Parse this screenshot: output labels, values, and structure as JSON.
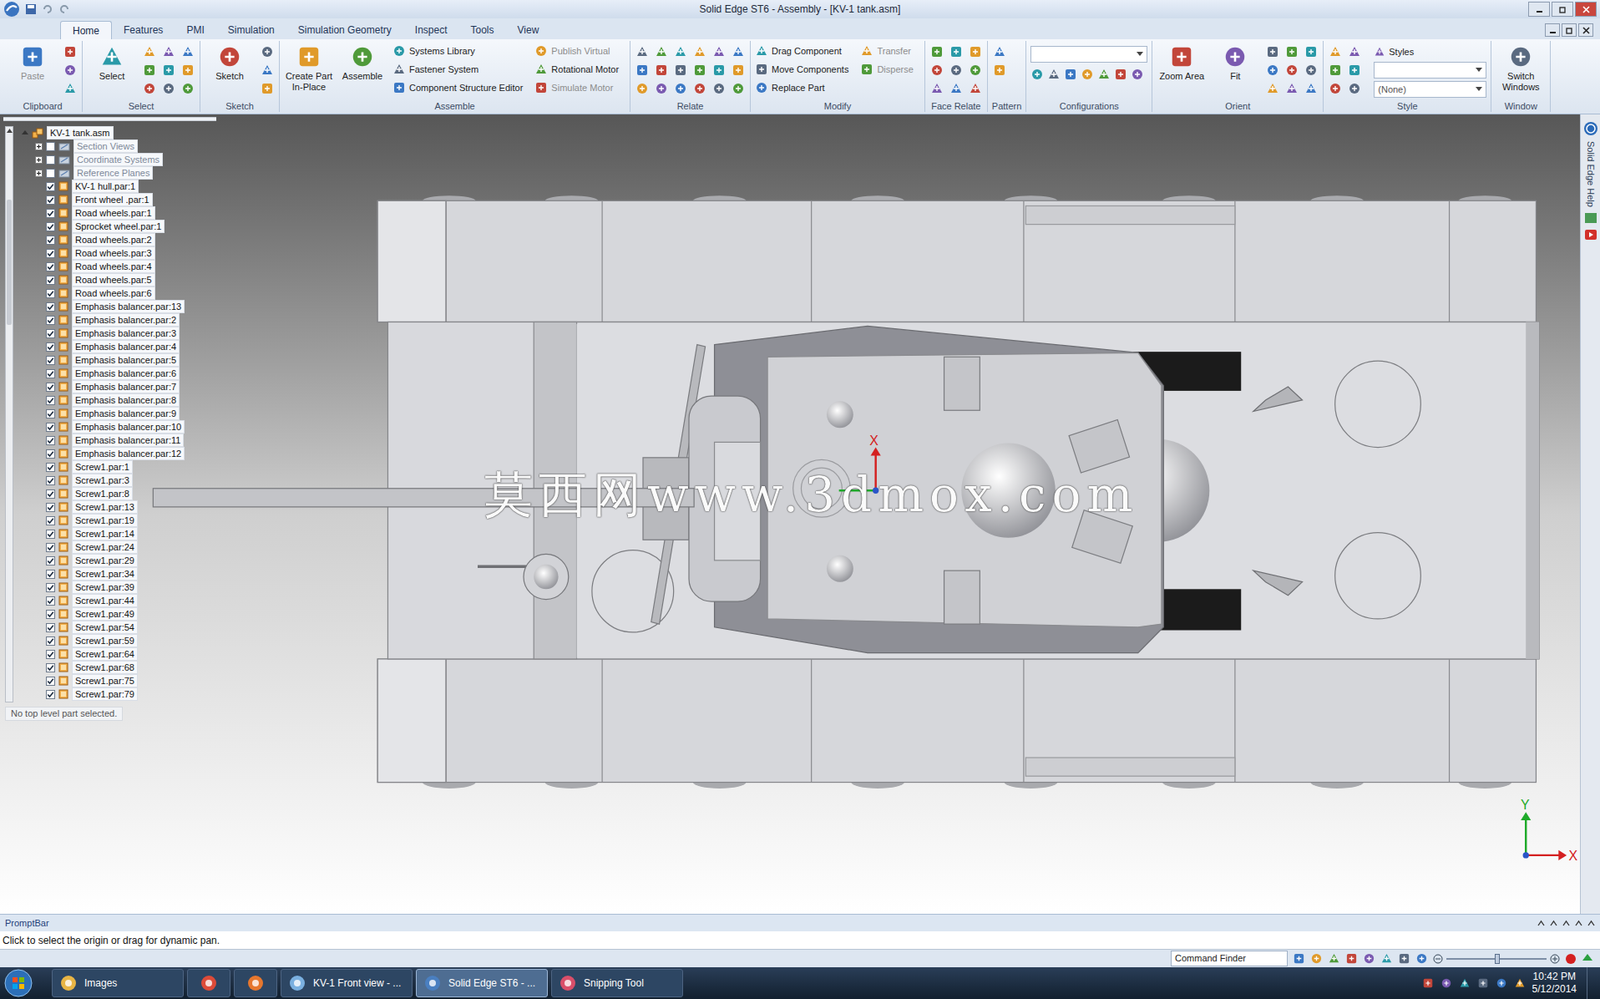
{
  "window": {
    "title": "Solid Edge ST6 - Assembly - [KV-1 tank.asm]"
  },
  "ribbon_tabs": [
    {
      "label": "Home",
      "selected": true
    },
    {
      "label": "Features",
      "selected": false
    },
    {
      "label": "PMI",
      "selected": false
    },
    {
      "label": "Simulation",
      "selected": false
    },
    {
      "label": "Simulation Geometry",
      "selected": false
    },
    {
      "label": "Inspect",
      "selected": false
    },
    {
      "label": "Tools",
      "selected": false
    },
    {
      "label": "View",
      "selected": false
    }
  ],
  "ribbon_groups": [
    {
      "label": "Clipboard",
      "columns": [
        {
          "kind": "large",
          "buttons": [
            {
              "label": "Paste",
              "disabled": true
            }
          ]
        },
        {
          "kind": "icons",
          "icons": 3
        }
      ]
    },
    {
      "label": "Select",
      "columns": [
        {
          "kind": "large",
          "buttons": [
            {
              "label": "Select",
              "disabled": false
            }
          ]
        },
        {
          "kind": "icons",
          "icons": 9
        }
      ]
    },
    {
      "label": "Sketch",
      "columns": [
        {
          "kind": "large",
          "buttons": [
            {
              "label": "Sketch",
              "disabled": false
            }
          ]
        },
        {
          "kind": "icons",
          "icons": 3
        }
      ]
    },
    {
      "label": "Assemble",
      "columns": [
        {
          "kind": "large",
          "buttons": [
            {
              "label": "Create Part In-Place",
              "disabled": false
            },
            {
              "label": "Assemble",
              "disabled": false
            }
          ]
        },
        {
          "kind": "small",
          "buttons": [
            {
              "label": "Systems Library",
              "disabled": false
            },
            {
              "label": "Fastener System",
              "disabled": false
            },
            {
              "label": "Component Structure Editor",
              "disabled": false
            }
          ]
        },
        {
          "kind": "small",
          "buttons": [
            {
              "label": "Publish Virtual",
              "disabled": true
            },
            {
              "label": "Rotational Motor",
              "disabled": false
            },
            {
              "label": "Simulate Motor",
              "disabled": true
            }
          ]
        }
      ]
    },
    {
      "label": "Relate",
      "columns": [
        {
          "kind": "icons",
          "icons": 18
        }
      ]
    },
    {
      "label": "Modify",
      "columns": [
        {
          "kind": "small",
          "buttons": [
            {
              "label": "Drag Component",
              "disabled": false
            },
            {
              "label": "Move Components",
              "disabled": false
            },
            {
              "label": "Replace Part",
              "disabled": false
            }
          ]
        },
        {
          "kind": "small",
          "buttons": [
            {
              "label": "Transfer",
              "disabled": true
            },
            {
              "label": "Disperse",
              "disabled": true
            }
          ]
        }
      ]
    },
    {
      "label": "Face Relate",
      "columns": [
        {
          "kind": "icons",
          "icons": 9
        }
      ]
    },
    {
      "label": "Pattern",
      "columns": [
        {
          "kind": "icons",
          "icons": 2
        }
      ]
    },
    {
      "label": "Configurations",
      "columns": [
        {
          "kind": "dropdown",
          "value": "",
          "icons": 7
        }
      ]
    },
    {
      "label": "Orient",
      "columns": [
        {
          "kind": "large",
          "buttons": [
            {
              "label": "Zoom Area",
              "disabled": false
            },
            {
              "label": "Fit",
              "disabled": false
            }
          ]
        },
        {
          "kind": "icons",
          "icons": 9
        }
      ]
    },
    {
      "label": "Style",
      "columns": [
        {
          "kind": "icons",
          "icons": 6
        },
        {
          "kind": "style",
          "title": "Styles",
          "value": "(None)"
        }
      ]
    },
    {
      "label": "Window",
      "columns": [
        {
          "kind": "large",
          "buttons": [
            {
              "label": "Switch Windows",
              "disabled": false
            }
          ]
        }
      ]
    }
  ],
  "tree": {
    "items": [
      {
        "label": "KV-1 tank.asm",
        "kind": "assembly",
        "expandable": true,
        "dimmed": false
      },
      {
        "label": "Section Views",
        "kind": "folder",
        "expandable": true,
        "checked": false,
        "dimmed": true
      },
      {
        "label": "Coordinate Systems",
        "kind": "folder",
        "expandable": true,
        "checked": false,
        "dimmed": true
      },
      {
        "label": "Reference Planes",
        "kind": "folder",
        "expandable": true,
        "checked": false,
        "dimmed": true
      },
      {
        "label": "KV-1 hull.par:1",
        "kind": "part",
        "expandable": false,
        "checked": true,
        "dimmed": false
      },
      {
        "label": "Front wheel .par:1",
        "kind": "part",
        "expandable": false,
        "checked": true,
        "dimmed": false
      },
      {
        "label": "Road wheels.par:1",
        "kind": "part",
        "expandable": false,
        "checked": true,
        "dimmed": false
      },
      {
        "label": "Sprocket wheel.par:1",
        "kind": "part",
        "expandable": false,
        "checked": true,
        "dimmed": false
      },
      {
        "label": "Road wheels.par:2",
        "kind": "part",
        "expandable": false,
        "checked": true,
        "dimmed": false
      },
      {
        "label": "Road wheels.par:3",
        "kind": "part",
        "expandable": false,
        "checked": true,
        "dimmed": false
      },
      {
        "label": "Road wheels.par:4",
        "kind": "part",
        "expandable": false,
        "checked": true,
        "dimmed": false
      },
      {
        "label": "Road wheels.par:5",
        "kind": "part",
        "expandable": false,
        "checked": true,
        "dimmed": false
      },
      {
        "label": "Road wheels.par:6",
        "kind": "part",
        "expandable": false,
        "checked": true,
        "dimmed": false
      },
      {
        "label": "Emphasis balancer.par:13",
        "kind": "part",
        "expandable": false,
        "checked": true,
        "dimmed": false
      },
      {
        "label": "Emphasis balancer.par:2",
        "kind": "part",
        "expandable": false,
        "checked": true,
        "dimmed": false
      },
      {
        "label": "Emphasis balancer.par:3",
        "kind": "part",
        "expandable": false,
        "checked": true,
        "dimmed": false
      },
      {
        "label": "Emphasis balancer.par:4",
        "kind": "part",
        "expandable": false,
        "checked": true,
        "dimmed": false
      },
      {
        "label": "Emphasis balancer.par:5",
        "kind": "part",
        "expandable": false,
        "checked": true,
        "dimmed": false
      },
      {
        "label": "Emphasis balancer.par:6",
        "kind": "part",
        "expandable": false,
        "checked": true,
        "dimmed": false
      },
      {
        "label": "Emphasis balancer.par:7",
        "kind": "part",
        "expandable": false,
        "checked": true,
        "dimmed": false
      },
      {
        "label": "Emphasis balancer.par:8",
        "kind": "part",
        "expandable": false,
        "checked": true,
        "dimmed": false
      },
      {
        "label": "Emphasis balancer.par:9",
        "kind": "part",
        "expandable": false,
        "checked": true,
        "dimmed": false
      },
      {
        "label": "Emphasis balancer.par:10",
        "kind": "part",
        "expandable": false,
        "checked": true,
        "dimmed": false
      },
      {
        "label": "Emphasis balancer.par:11",
        "kind": "part",
        "expandable": false,
        "checked": true,
        "dimmed": false
      },
      {
        "label": "Emphasis balancer.par:12",
        "kind": "part",
        "expandable": false,
        "checked": true,
        "dimmed": false
      },
      {
        "label": "Screw1.par:1",
        "kind": "part",
        "expandable": false,
        "checked": true,
        "dimmed": false
      },
      {
        "label": "Screw1.par:3",
        "kind": "part",
        "expandable": false,
        "checked": true,
        "dimmed": false
      },
      {
        "label": "Screw1.par:8",
        "kind": "part",
        "expandable": false,
        "checked": true,
        "dimmed": false
      },
      {
        "label": "Screw1.par:13",
        "kind": "part",
        "expandable": false,
        "checked": true,
        "dimmed": false
      },
      {
        "label": "Screw1.par:19",
        "kind": "part",
        "expandable": false,
        "checked": true,
        "dimmed": false
      },
      {
        "label": "Screw1.par:14",
        "kind": "part",
        "expandable": false,
        "checked": true,
        "dimmed": false
      },
      {
        "label": "Screw1.par:24",
        "kind": "part",
        "expandable": false,
        "checked": true,
        "dimmed": false
      },
      {
        "label": "Screw1.par:29",
        "kind": "part",
        "expandable": false,
        "checked": true,
        "dimmed": false
      },
      {
        "label": "Screw1.par:34",
        "kind": "part",
        "expandable": false,
        "checked": true,
        "dimmed": false
      },
      {
        "label": "Screw1.par:39",
        "kind": "part",
        "expandable": false,
        "checked": true,
        "dimmed": false
      },
      {
        "label": "Screw1.par:44",
        "kind": "part",
        "expandable": false,
        "checked": true,
        "dimmed": false
      },
      {
        "label": "Screw1.par:49",
        "kind": "part",
        "expandable": false,
        "checked": true,
        "dimmed": false
      },
      {
        "label": "Screw1.par:54",
        "kind": "part",
        "expandable": false,
        "checked": true,
        "dimmed": false
      },
      {
        "label": "Screw1.par:59",
        "kind": "part",
        "expandable": false,
        "checked": true,
        "dimmed": false
      },
      {
        "label": "Screw1.par:64",
        "kind": "part",
        "expandable": false,
        "checked": true,
        "dimmed": false
      },
      {
        "label": "Screw1.par:68",
        "kind": "part",
        "expandable": false,
        "checked": true,
        "dimmed": false
      },
      {
        "label": "Screw1.par:75",
        "kind": "part",
        "expandable": false,
        "checked": true,
        "dimmed": false
      },
      {
        "label": "Screw1.par:79",
        "kind": "part",
        "expandable": false,
        "checked": true,
        "dimmed": false
      }
    ],
    "status": "No top level part selected."
  },
  "viewport": {
    "watermark": "莫西网www.3dmox.com",
    "origin_label": "X",
    "triad": {
      "x": "X",
      "y": "Y"
    }
  },
  "help_tab": "Solid Edge Help",
  "prompt_bar": {
    "title": "PromptBar",
    "text": "Click to select the origin or drag for dynamic pan."
  },
  "status_bar": {
    "command_finder": "Command Finder"
  },
  "taskbar": {
    "items": [
      {
        "kind": "labeled",
        "label": "Images",
        "selected": false
      },
      {
        "kind": "icon",
        "selected": false
      },
      {
        "kind": "icon",
        "selected": false
      },
      {
        "kind": "labeled",
        "label": "KV-1 Front view - ...",
        "selected": false
      },
      {
        "kind": "labeled",
        "label": "Solid Edge ST6 - ...",
        "selected": true
      },
      {
        "kind": "labeled",
        "label": "Snipping Tool",
        "selected": false
      }
    ],
    "time": "10:42 PM",
    "date": "5/12/2014"
  }
}
